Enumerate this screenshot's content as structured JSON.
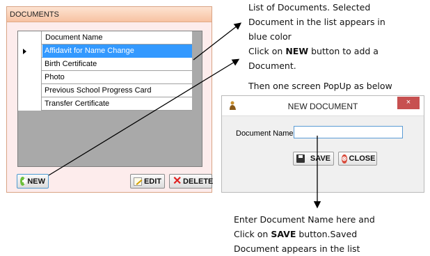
{
  "panel": {
    "title": "DOCUMENTS",
    "column_header": "Document Name",
    "rows": [
      "Affidavit for Name Change",
      "Birth Certificate",
      "Photo",
      "Previous School Progress Card",
      "Transfer Certificate"
    ],
    "selected_row": 0,
    "buttons": {
      "new": "NEW",
      "edit": "EDIT",
      "delete": "DELETE"
    }
  },
  "notes": {
    "list_1": "List of Documents. Selected",
    "list_2": "Document in the list appears in",
    "list_3": "blue color",
    "new_pre": "Click on ",
    "new_bold": "NEW",
    "new_post": " button to add  a",
    "new_2": "Document.",
    "popup": "Then one screen PopUp as below",
    "enter_1": "Enter Document Name  here and",
    "enter_2_pre": "Click on ",
    "enter_2_bold": "SAVE",
    "enter_2_post": " button.Saved",
    "enter_3": "Document appears in the list"
  },
  "dialog": {
    "title": "NEW DOCUMENT",
    "close_glyph": "×",
    "field_label": "Document Name:",
    "field_value": "",
    "save_label": "SAVE",
    "close_label": "CLOSE"
  },
  "colors": {
    "selected_row": "#3399ff",
    "panel_header": "#f7c2a2",
    "panel_body": "#fdecec",
    "close_button": "#c75050"
  },
  "icons": {
    "new": "plus-circle-icon",
    "edit": "pencil-icon",
    "delete": "x-icon",
    "save": "floppy-disk-icon",
    "close": "stop-icon"
  }
}
